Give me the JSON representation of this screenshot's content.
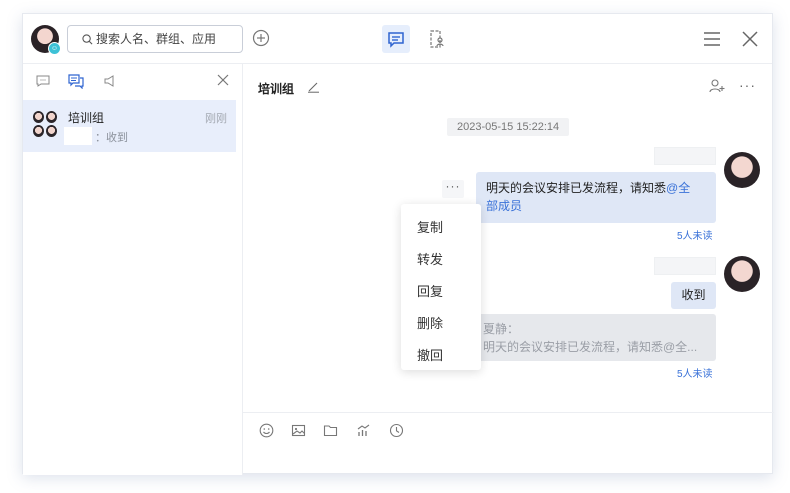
{
  "topbar": {
    "search_placeholder": "搜索人名、群组、应用",
    "avatar_badge": "☺"
  },
  "sidebar": {
    "conversations": [
      {
        "name": "培训组",
        "time": "刚刚",
        "preview": "：收到"
      }
    ]
  },
  "chat": {
    "title": "培训组",
    "timestamp": "2023-05-15 15:22:14",
    "messages": [
      {
        "text_plain": "明天的会议安排已发流程，请知悉",
        "mention_1": "@全",
        "mention_2": "部成员",
        "read_status": "5人未读"
      },
      {
        "text": "收到",
        "quote_name": "夏静：",
        "quote_text": "明天的会议安排已发流程，请知悉@全...",
        "read_status": "5人未读"
      }
    ],
    "more_dots": "···",
    "top_more": "···"
  },
  "context_menu": {
    "items": [
      "复制",
      "转发",
      "回复",
      "删除",
      "撤回"
    ]
  },
  "colors": {
    "accent": "#3a72d8",
    "bubble": "#dfe7f6",
    "selected_conversation": "#e8eefb"
  }
}
